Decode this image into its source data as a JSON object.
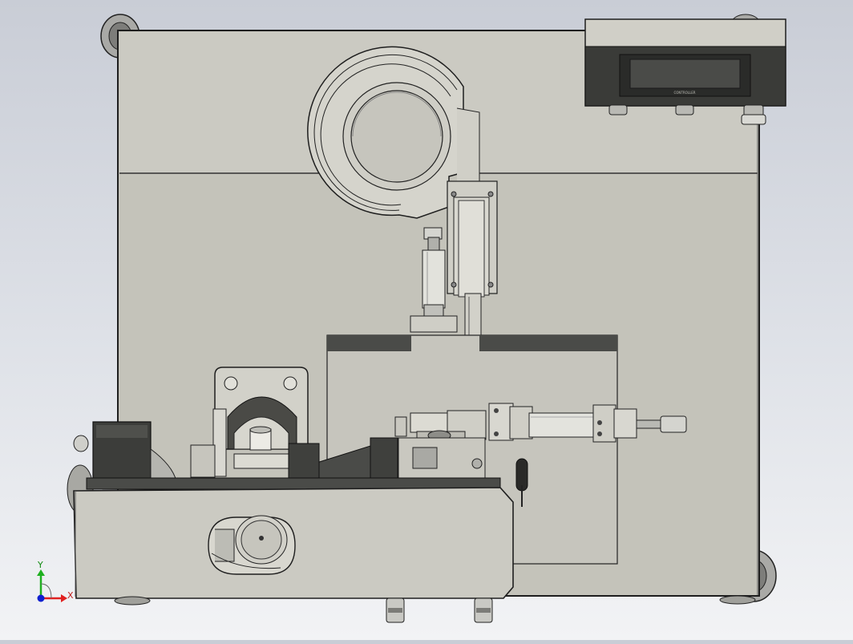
{
  "viewport": {
    "background_top": "#c9cdd6",
    "background_bottom": "#f2f3f5"
  },
  "palette": {
    "panel": "#c4c3ba",
    "panel_light": "#d6d5cc",
    "edge": "#2a2a2a",
    "dark_housing": "#3a3b38",
    "lcd": "#4a4b48",
    "metal": "#b7b7b2",
    "metal_light": "#e4e4df"
  },
  "triad": {
    "x_label": "X",
    "y_label": "Y",
    "x_color": "#e02020",
    "y_color": "#1fb01f",
    "origin_color": "#1020d0"
  },
  "display_unit": {
    "logo_text": "CONTROLLER"
  }
}
